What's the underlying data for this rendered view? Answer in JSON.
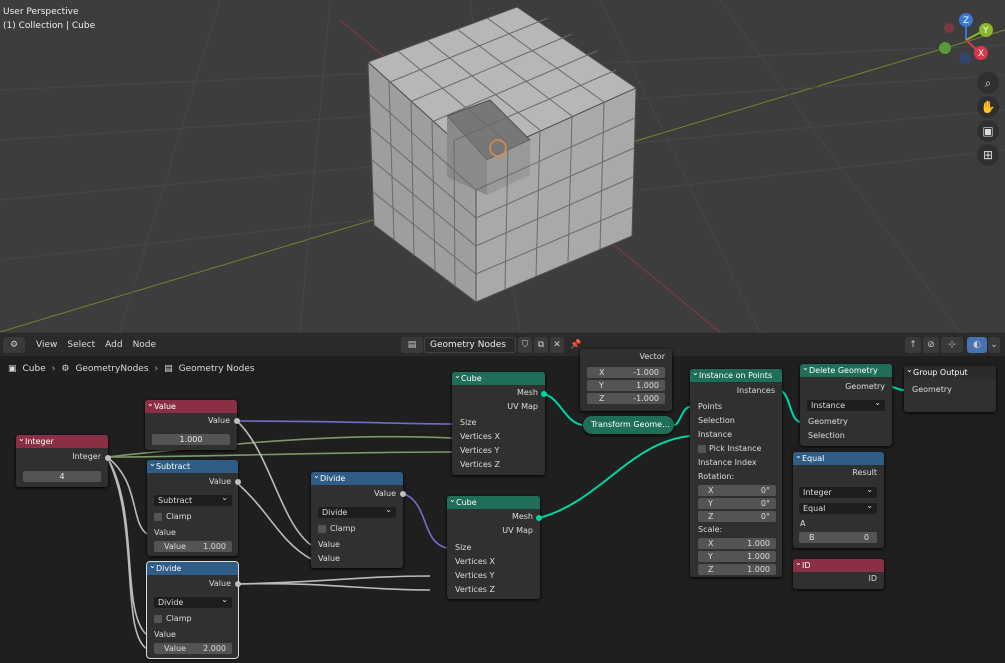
{
  "viewport": {
    "title": "User Perspective",
    "subtitle": "(1) Collection | Cube",
    "gizmo": {
      "z": "Z",
      "y": "Y",
      "x": "X"
    },
    "nav_icons": [
      "zoom-icon",
      "hand-pan-icon",
      "camera-icon",
      "grid-icon"
    ]
  },
  "header": {
    "menus": [
      "View",
      "Select",
      "Add",
      "Node"
    ],
    "node_tree": "Geometry Nodes"
  },
  "breadcrumb": [
    "Cube",
    "GeometryNodes",
    "Geometry Nodes"
  ],
  "nodes": {
    "integer": {
      "title": "Integer",
      "out": "Integer",
      "value": "4"
    },
    "value": {
      "title": "Value",
      "out": "Value",
      "value": "1.000"
    },
    "subtract": {
      "title": "Subtract",
      "out": "Value",
      "op": "Subtract",
      "clamp": "Clamp",
      "in1": "Value",
      "in2": "Value",
      "in2_val": "1.000"
    },
    "divide1": {
      "title": "Divide",
      "out": "Value",
      "op": "Divide",
      "clamp": "Clamp",
      "in1": "Value",
      "in2": "Value",
      "in2_val": "2.000"
    },
    "divide2": {
      "title": "Divide",
      "out": "Value",
      "op": "Divide",
      "clamp": "Clamp",
      "in1": "Value",
      "in2": "Value"
    },
    "cube1": {
      "title": "Cube",
      "mesh": "Mesh",
      "uv": "UV Map",
      "size": "Size",
      "vx": "Vertices X",
      "vy": "Vertices Y",
      "vz": "Vertices Z"
    },
    "cube2": {
      "title": "Cube",
      "mesh": "Mesh",
      "uv": "UV Map",
      "size": "Size",
      "vx": "Vertices X",
      "vy": "Vertices Y",
      "vz": "Vertices Z"
    },
    "vector": {
      "out": "Vector",
      "x": "X",
      "y": "Y",
      "z": "Z",
      "xv": "-1.000",
      "yv": "1.000",
      "zv": "-1.000"
    },
    "transform": {
      "title": "Transform Geome..."
    },
    "iop": {
      "title": "Instance on Points",
      "out": "Instances",
      "points": "Points",
      "selection": "Selection",
      "instance": "Instance",
      "pick": "Pick Instance",
      "index": "Instance Index",
      "rotation": "Rotation:",
      "rx": "0°",
      "ry": "0°",
      "rz": "0°",
      "scale": "Scale:",
      "sx": "1.000",
      "sy": "1.000",
      "sz": "1.000",
      "X": "X",
      "Y": "Y",
      "Z": "Z"
    },
    "delete": {
      "title": "Delete Geometry",
      "out": "Geometry",
      "domain": "Instance",
      "geo": "Geometry",
      "selection": "Selection"
    },
    "output": {
      "title": "Group Output",
      "geo": "Geometry"
    },
    "equal": {
      "title": "Equal",
      "out": "Result",
      "type": "Integer",
      "op": "Equal",
      "a": "A",
      "b": "B",
      "bv": "0"
    },
    "id": {
      "title": "ID",
      "out": "ID"
    }
  }
}
